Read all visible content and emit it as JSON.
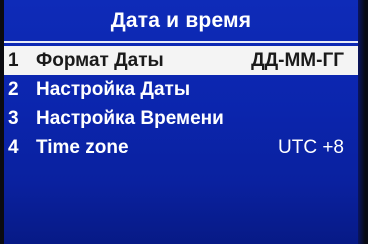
{
  "header": {
    "title": "Дата и время"
  },
  "menu": {
    "items": [
      {
        "number": "1",
        "label": "Формат Даты",
        "value": "ДД-ММ-ГГ",
        "selected": true
      },
      {
        "number": "2",
        "label": "Настройка Даты",
        "value": "",
        "selected": false
      },
      {
        "number": "3",
        "label": "Настройка Времени",
        "value": "",
        "selected": false
      },
      {
        "number": "4",
        "label": "Time zone",
        "value": "UTC +8",
        "selected": false
      }
    ]
  },
  "colors": {
    "background": "#0b25ad",
    "highlight": "#f4f4f4",
    "highlight_text": "#1a1a1a",
    "text": "#ffffff"
  }
}
